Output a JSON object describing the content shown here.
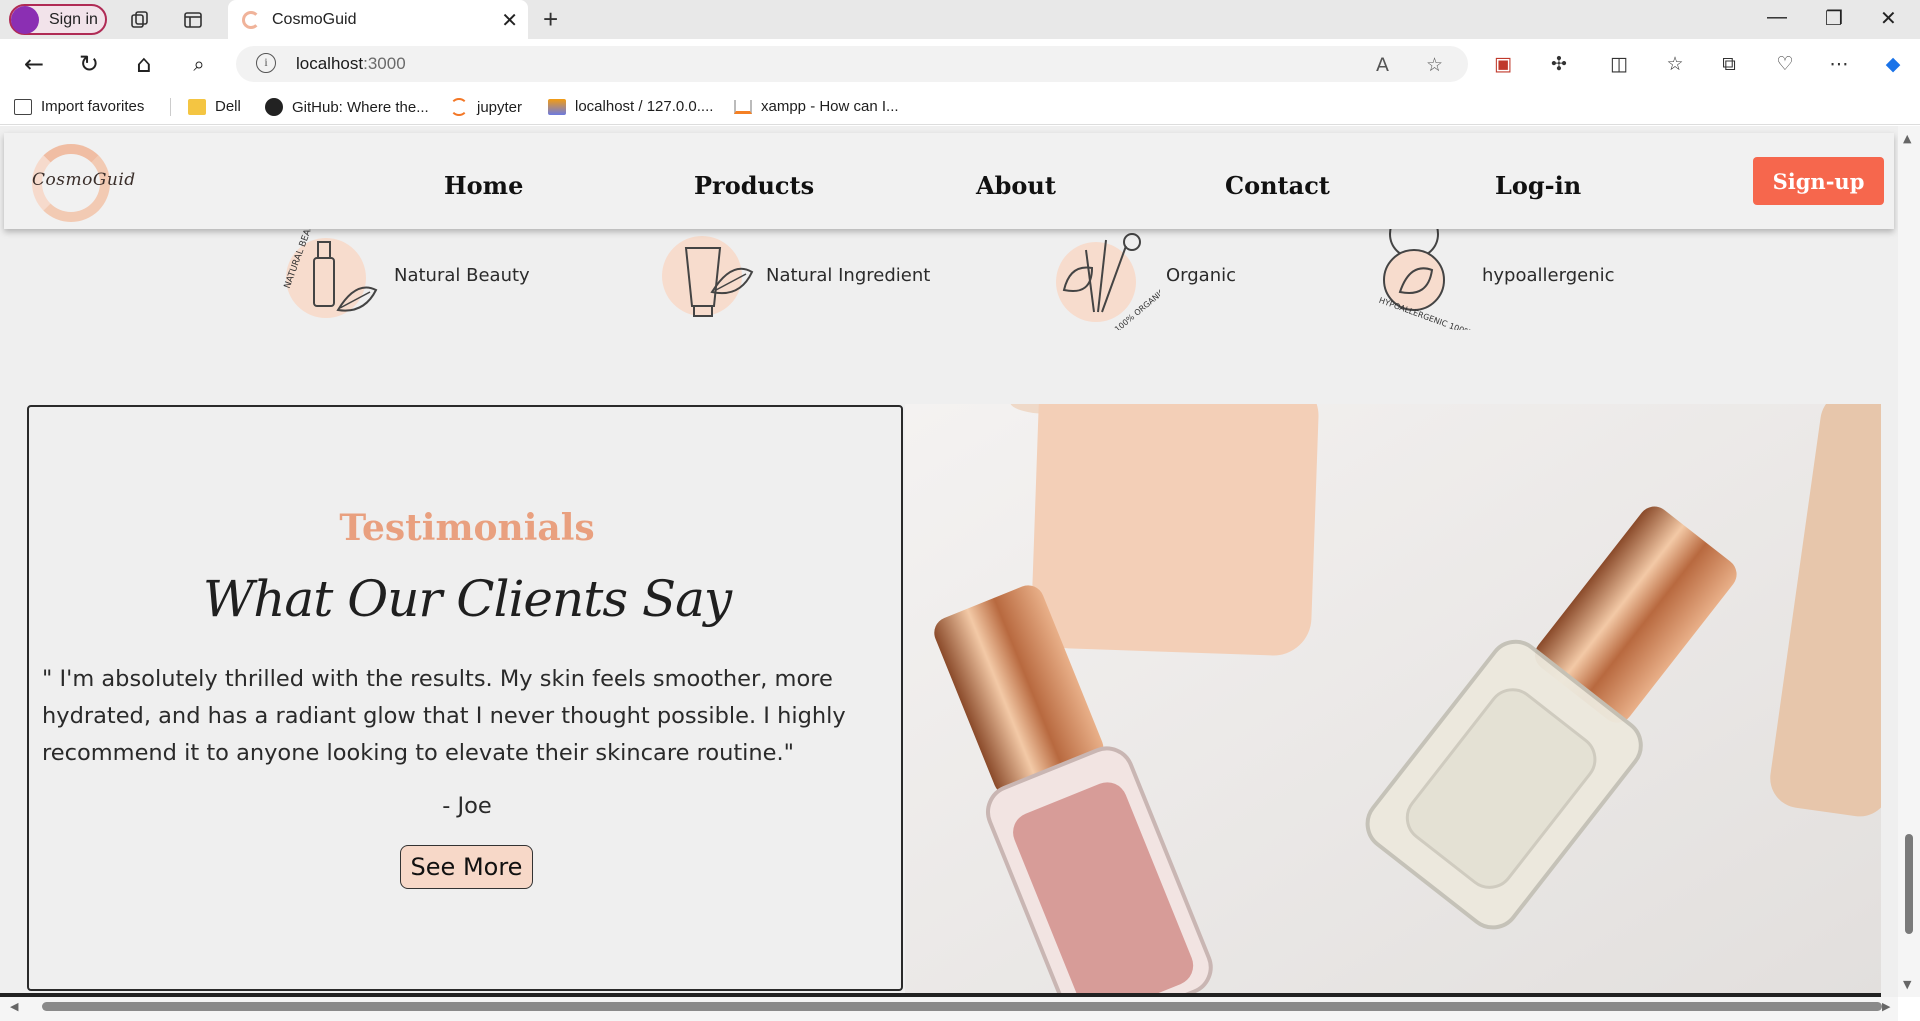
{
  "browser": {
    "profile_label": "Sign in",
    "tab_title": "CosmoGuid",
    "url_host": "localhost",
    "url_port": ":3000",
    "bookmarks": [
      {
        "label": "Import favorites"
      },
      {
        "label": "Dell"
      },
      {
        "label": "GitHub: Where the..."
      },
      {
        "label": "jupyter"
      },
      {
        "label": "localhost / 127.0.0...."
      },
      {
        "label": "xampp - How can I..."
      }
    ],
    "colors": {
      "profile_avatar": "#8b2fb3",
      "accent_edge": "#1a73e8"
    }
  },
  "site": {
    "logo_text": "CosmoGuid",
    "nav": {
      "home": "Home",
      "products": "Products",
      "about": "About",
      "contact": "Contact",
      "login": "Log-in",
      "signup": "Sign-up"
    },
    "features": [
      {
        "label": "Natural Beauty",
        "icon": "lipstick-leaf-icon"
      },
      {
        "label": "Natural Ingredient",
        "icon": "tube-leaf-icon"
      },
      {
        "label": "Organic",
        "icon": "brushes-leaf-icon"
      },
      {
        "label": "hypoallergenic",
        "icon": "compact-leaf-icon"
      }
    ],
    "testimonials": {
      "heading": "Testimonials",
      "title": "What Our Clients Say",
      "quote": "\" I'm absolutely thrilled with the results. My skin feels smoother, more hydrated, and has a radiant glow that I never thought possible. I highly recommend it to anyone looking to elevate their skincare routine.\"",
      "author": "- Joe",
      "button": "See More"
    },
    "colors": {
      "accent": "#f6674d",
      "heading_peach": "#e9a07f",
      "button_peach": "#f7d8c8"
    }
  }
}
